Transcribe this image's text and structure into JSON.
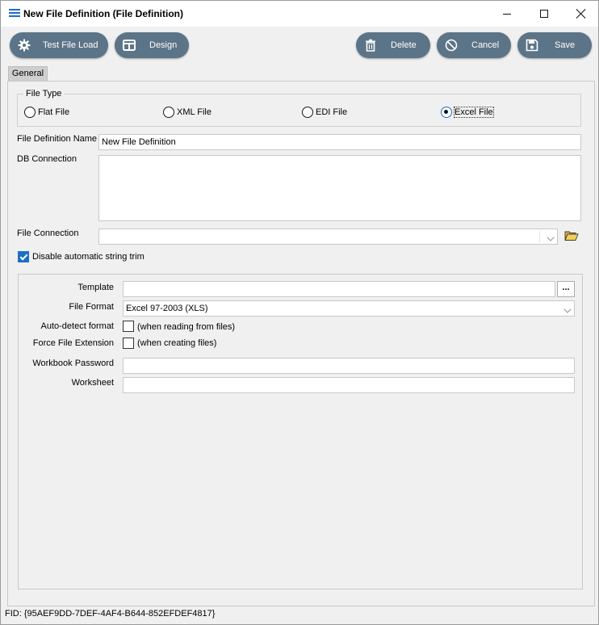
{
  "window": {
    "title": "New File Definition (File Definition)",
    "icon": "menu-lines-icon"
  },
  "toolbar": {
    "test_file_load": "Test File Load",
    "design": "Design",
    "delete": "Delete",
    "cancel": "Cancel",
    "save": "Save"
  },
  "tabs": {
    "general": "General"
  },
  "file_type": {
    "legend": "File Type",
    "options": [
      "Flat File",
      "XML File",
      "EDI File",
      "Excel File"
    ],
    "selected": "Excel File"
  },
  "form": {
    "file_definition_name_label": "File Definition Name",
    "file_definition_name_value": "New File Definition",
    "db_connection_label": "DB Connection",
    "db_connection_value": "",
    "file_connection_label": "File Connection",
    "file_connection_value": "",
    "disable_trim_label": "Disable automatic string trim",
    "disable_trim_checked": true
  },
  "excel": {
    "template_label": "Template",
    "template_value": "",
    "template_browse": "...",
    "file_format_label": "File Format",
    "file_format_value": "Excel 97-2003 (XLS)",
    "auto_detect_label": "Auto-detect format",
    "auto_detect_note": "(when reading from files)",
    "force_ext_label": "Force File Extension",
    "force_ext_note": "(when creating files)",
    "workbook_password_label": "Workbook Password",
    "workbook_password_value": "",
    "worksheet_label": "Worksheet",
    "worksheet_value": ""
  },
  "status": {
    "fid": "FID: {95AEF9DD-7DEF-4AF4-B644-852EFDEF4817}"
  },
  "colors": {
    "button_bg": "#5c7487",
    "accent": "#1c6fc7"
  }
}
